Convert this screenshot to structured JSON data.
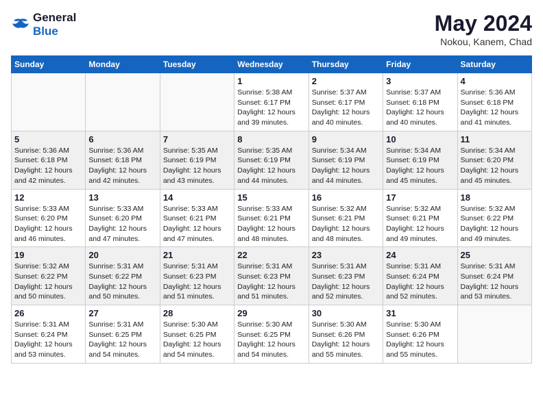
{
  "logo": {
    "line1": "General",
    "line2": "Blue"
  },
  "title": {
    "month_year": "May 2024",
    "location": "Nokou, Kanem, Chad"
  },
  "weekdays": [
    "Sunday",
    "Monday",
    "Tuesday",
    "Wednesday",
    "Thursday",
    "Friday",
    "Saturday"
  ],
  "weeks": [
    [
      {
        "day": "",
        "info": ""
      },
      {
        "day": "",
        "info": ""
      },
      {
        "day": "",
        "info": ""
      },
      {
        "day": "1",
        "info": "Sunrise: 5:38 AM\nSunset: 6:17 PM\nDaylight: 12 hours\nand 39 minutes."
      },
      {
        "day": "2",
        "info": "Sunrise: 5:37 AM\nSunset: 6:17 PM\nDaylight: 12 hours\nand 40 minutes."
      },
      {
        "day": "3",
        "info": "Sunrise: 5:37 AM\nSunset: 6:18 PM\nDaylight: 12 hours\nand 40 minutes."
      },
      {
        "day": "4",
        "info": "Sunrise: 5:36 AM\nSunset: 6:18 PM\nDaylight: 12 hours\nand 41 minutes."
      }
    ],
    [
      {
        "day": "5",
        "info": "Sunrise: 5:36 AM\nSunset: 6:18 PM\nDaylight: 12 hours\nand 42 minutes."
      },
      {
        "day": "6",
        "info": "Sunrise: 5:36 AM\nSunset: 6:18 PM\nDaylight: 12 hours\nand 42 minutes."
      },
      {
        "day": "7",
        "info": "Sunrise: 5:35 AM\nSunset: 6:19 PM\nDaylight: 12 hours\nand 43 minutes."
      },
      {
        "day": "8",
        "info": "Sunrise: 5:35 AM\nSunset: 6:19 PM\nDaylight: 12 hours\nand 44 minutes."
      },
      {
        "day": "9",
        "info": "Sunrise: 5:34 AM\nSunset: 6:19 PM\nDaylight: 12 hours\nand 44 minutes."
      },
      {
        "day": "10",
        "info": "Sunrise: 5:34 AM\nSunset: 6:19 PM\nDaylight: 12 hours\nand 45 minutes."
      },
      {
        "day": "11",
        "info": "Sunrise: 5:34 AM\nSunset: 6:20 PM\nDaylight: 12 hours\nand 45 minutes."
      }
    ],
    [
      {
        "day": "12",
        "info": "Sunrise: 5:33 AM\nSunset: 6:20 PM\nDaylight: 12 hours\nand 46 minutes."
      },
      {
        "day": "13",
        "info": "Sunrise: 5:33 AM\nSunset: 6:20 PM\nDaylight: 12 hours\nand 47 minutes."
      },
      {
        "day": "14",
        "info": "Sunrise: 5:33 AM\nSunset: 6:21 PM\nDaylight: 12 hours\nand 47 minutes."
      },
      {
        "day": "15",
        "info": "Sunrise: 5:33 AM\nSunset: 6:21 PM\nDaylight: 12 hours\nand 48 minutes."
      },
      {
        "day": "16",
        "info": "Sunrise: 5:32 AM\nSunset: 6:21 PM\nDaylight: 12 hours\nand 48 minutes."
      },
      {
        "day": "17",
        "info": "Sunrise: 5:32 AM\nSunset: 6:21 PM\nDaylight: 12 hours\nand 49 minutes."
      },
      {
        "day": "18",
        "info": "Sunrise: 5:32 AM\nSunset: 6:22 PM\nDaylight: 12 hours\nand 49 minutes."
      }
    ],
    [
      {
        "day": "19",
        "info": "Sunrise: 5:32 AM\nSunset: 6:22 PM\nDaylight: 12 hours\nand 50 minutes."
      },
      {
        "day": "20",
        "info": "Sunrise: 5:31 AM\nSunset: 6:22 PM\nDaylight: 12 hours\nand 50 minutes."
      },
      {
        "day": "21",
        "info": "Sunrise: 5:31 AM\nSunset: 6:23 PM\nDaylight: 12 hours\nand 51 minutes."
      },
      {
        "day": "22",
        "info": "Sunrise: 5:31 AM\nSunset: 6:23 PM\nDaylight: 12 hours\nand 51 minutes."
      },
      {
        "day": "23",
        "info": "Sunrise: 5:31 AM\nSunset: 6:23 PM\nDaylight: 12 hours\nand 52 minutes."
      },
      {
        "day": "24",
        "info": "Sunrise: 5:31 AM\nSunset: 6:24 PM\nDaylight: 12 hours\nand 52 minutes."
      },
      {
        "day": "25",
        "info": "Sunrise: 5:31 AM\nSunset: 6:24 PM\nDaylight: 12 hours\nand 53 minutes."
      }
    ],
    [
      {
        "day": "26",
        "info": "Sunrise: 5:31 AM\nSunset: 6:24 PM\nDaylight: 12 hours\nand 53 minutes."
      },
      {
        "day": "27",
        "info": "Sunrise: 5:31 AM\nSunset: 6:25 PM\nDaylight: 12 hours\nand 54 minutes."
      },
      {
        "day": "28",
        "info": "Sunrise: 5:30 AM\nSunset: 6:25 PM\nDaylight: 12 hours\nand 54 minutes."
      },
      {
        "day": "29",
        "info": "Sunrise: 5:30 AM\nSunset: 6:25 PM\nDaylight: 12 hours\nand 54 minutes."
      },
      {
        "day": "30",
        "info": "Sunrise: 5:30 AM\nSunset: 6:26 PM\nDaylight: 12 hours\nand 55 minutes."
      },
      {
        "day": "31",
        "info": "Sunrise: 5:30 AM\nSunset: 6:26 PM\nDaylight: 12 hours\nand 55 minutes."
      },
      {
        "day": "",
        "info": ""
      }
    ]
  ]
}
